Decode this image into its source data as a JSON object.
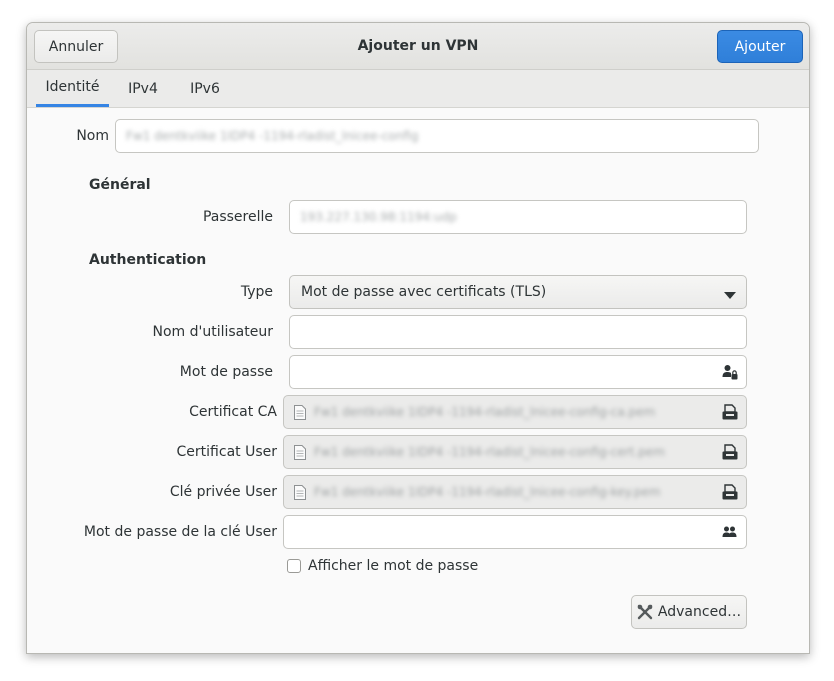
{
  "header": {
    "cancel_label": "Annuler",
    "title": "Ajouter un VPN",
    "add_label": "Ajouter"
  },
  "tabs": [
    {
      "label": "Identité",
      "active": true
    },
    {
      "label": "IPv4",
      "active": false
    },
    {
      "label": "IPv6",
      "active": false
    }
  ],
  "form": {
    "name_label": "Nom",
    "name_value": "Fw1 dentkviike 1IDP4 -1194-rladist_lnicee-config",
    "general_section": "Général",
    "gateway_label": "Passerelle",
    "gateway_value": "193.227.130.98:1194:udp",
    "auth_section": "Authentication",
    "type_label": "Type",
    "type_value": "Mot de passe avec certificats (TLS)",
    "username_label": "Nom d'utilisateur",
    "username_value": "",
    "password_label": "Mot de passe",
    "password_value": "",
    "ca_cert_label": "Certificat CA",
    "ca_cert_value": "Fw1 dentkviike 1IDP4 -1194-rladist_lnicee-config-ca.pem",
    "user_cert_label": "Certificat User",
    "user_cert_value": "Fw1 dentkviike 1IDP4 -1194-rladist_lnicee-config-cert.pem",
    "private_key_label": "Clé privée User",
    "private_key_value": "Fw1 dentkviike 1IDP4 -1194-rladist_lnicee-config-key.pem",
    "key_password_label": "Mot de passe de la clé User",
    "key_password_value": "",
    "show_password_label": "Afficher le mot de passe",
    "show_password_checked": false,
    "advanced_label": "Advanced…"
  },
  "icons": {
    "dropdown": "chevron-down-icon",
    "password_owner": "person-lock-icon",
    "key_password_owner": "people-icon",
    "file_document": "document-icon",
    "file_open": "open-folder-icon",
    "advanced": "tools-icon"
  },
  "colors": {
    "accent": "#3584e4",
    "accent_button": "#3b8be3"
  }
}
